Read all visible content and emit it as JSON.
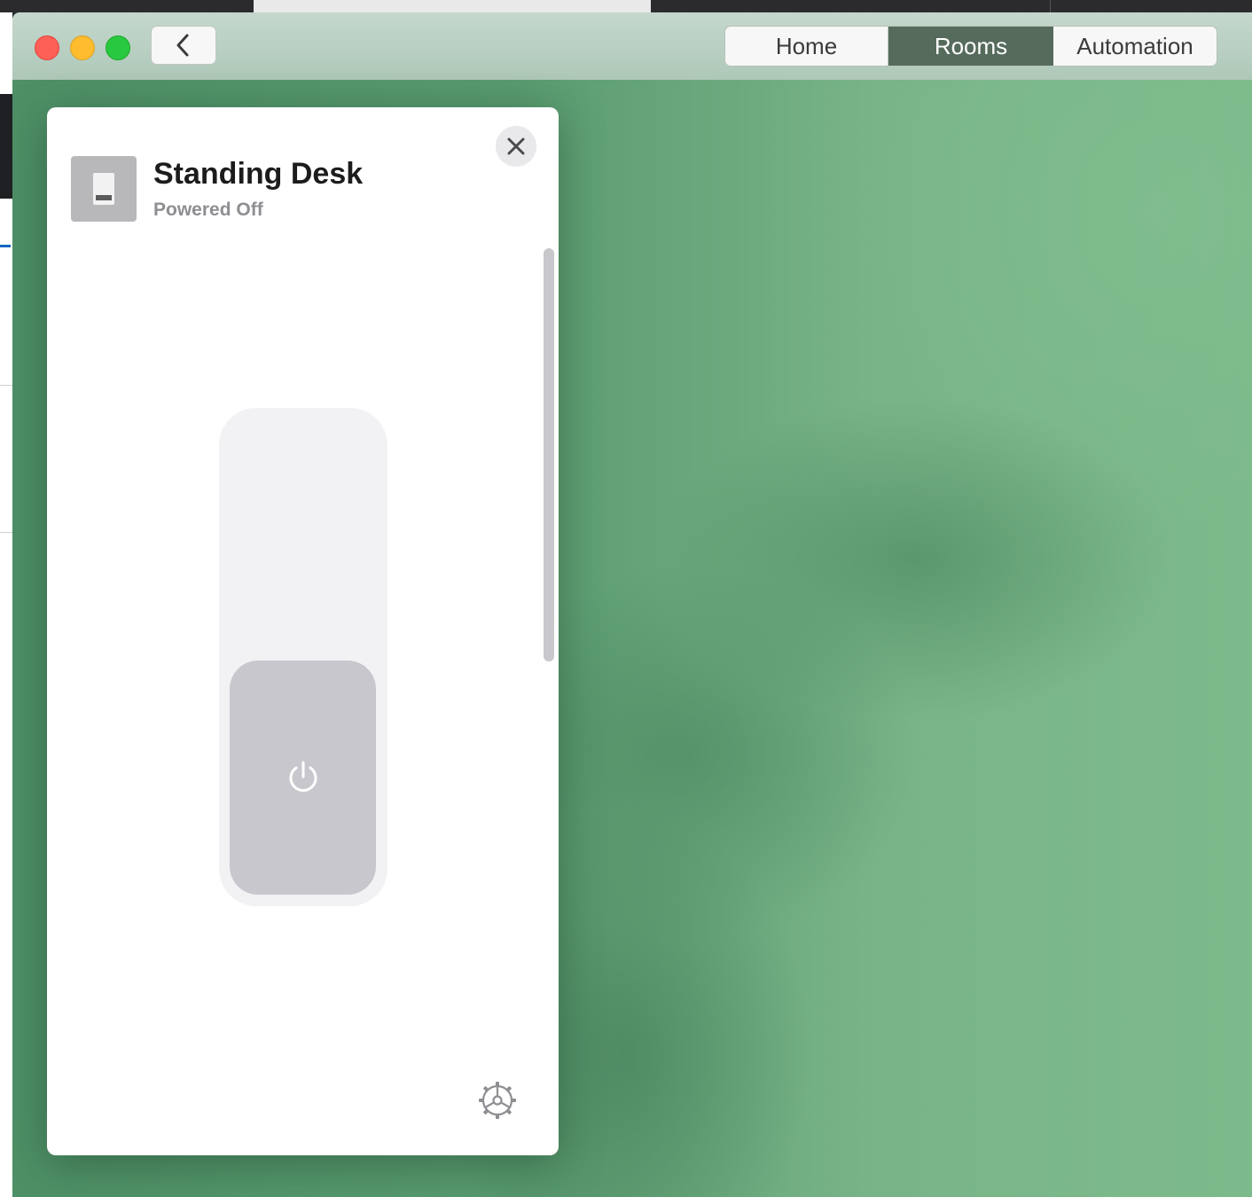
{
  "window": {
    "title_controls": {
      "close": "close",
      "minimize": "minimize",
      "zoom": "zoom"
    },
    "back_icon": "chevron-left-icon"
  },
  "nav": {
    "tabs": [
      {
        "label": "Home",
        "selected": false
      },
      {
        "label": "Rooms",
        "selected": true
      },
      {
        "label": "Automation",
        "selected": false
      }
    ]
  },
  "accessory": {
    "name": "Standing Desk",
    "status": "Powered Off",
    "icon": "light-switch-icon",
    "power_state": "off",
    "power_icon": "power-icon",
    "close_icon": "close-icon",
    "settings_icon": "gear-icon"
  },
  "colors": {
    "selected_tab": "#566b5c",
    "background_green": "#5a9b70",
    "knob": "#c7c7cd"
  }
}
